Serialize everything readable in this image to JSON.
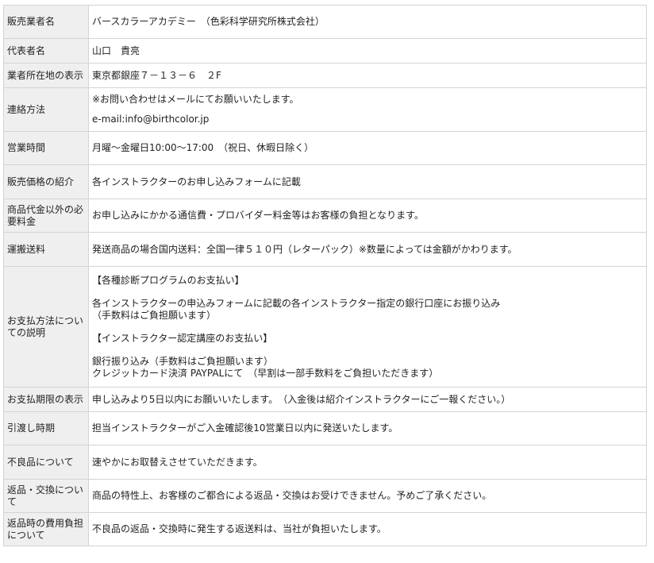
{
  "rows": [
    {
      "label": "販売業者名",
      "lines": [
        "バースカラーアカデミー　（色彩科学研究所株式会社）"
      ]
    },
    {
      "label": "代表者名",
      "lines": [
        "山口　貴亮"
      ]
    },
    {
      "label": "業者所在地の表示",
      "lines": [
        "東京都銀座７－１３－６　２F"
      ]
    },
    {
      "label": "連絡方法",
      "lines": [
        "※お問い合わせはメールにてお願いいたします。",
        "e-mail:info@birthcolor.jp"
      ]
    },
    {
      "label": "営業時間",
      "lines": [
        "月曜～金曜日10:00～17:00　（祝日、休暇日除く）"
      ]
    },
    {
      "label": "販売価格の紹介",
      "lines": [
        "各インストラクターのお申し込みフォームに記載"
      ]
    },
    {
      "label": "商品代金以外の必要料金",
      "lines": [
        "お申し込みにかかる通信費・プロバイダー料金等はお客様の負担となります。"
      ]
    },
    {
      "label": "運搬送料",
      "lines": [
        "発送商品の場合国内送料：全国一律５１０円（レターパック）※数量によっては金額がかわります。"
      ]
    },
    {
      "label": "お支払方法についての説明",
      "lines": [
        "【各種診断プログラムのお支払い】",
        "各インストラクターの申込みフォームに記載の各インストラクター指定の銀行口座にお振り込み",
        "（手数料はご負担願います）",
        "【インストラクター認定講座のお支払い】",
        "銀行振り込み（手数料はご負担願います）",
        "クレジットカード決済 PAYPALにて　（早割は一部手数料をご負担いただきます）"
      ]
    },
    {
      "label": "お支払期限の表示",
      "lines": [
        "申し込みより5日以内にお願いいたします。　（入金後は紹介インストラクターにご一報ください。）"
      ]
    },
    {
      "label": "引渡し時期",
      "lines": [
        "担当インストラクターがご入金確認後10営業日以内に発送いたします。"
      ]
    },
    {
      "label": "不良品について",
      "lines": [
        "速やかにお取替えさせていただきます。"
      ]
    },
    {
      "label": "返品・交換について",
      "lines": [
        "商品の特性上、お客様のご都合による返品・交換はお受けできません。予めご了承ください。"
      ]
    },
    {
      "label": "返品時の費用負担について",
      "lines": [
        "不良品の返品・交換時に発生する返送料は、当社が負担いたします。"
      ]
    }
  ]
}
